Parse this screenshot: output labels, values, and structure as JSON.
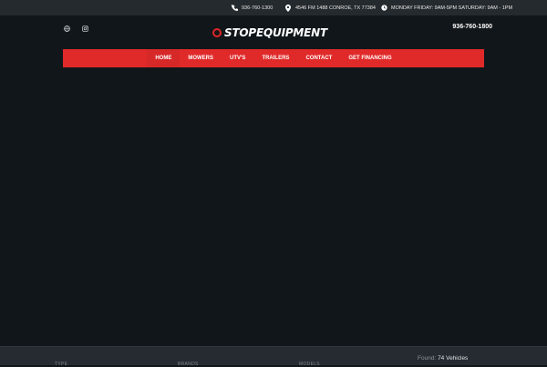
{
  "topbar": {
    "phone": "936-760-1300",
    "address": "4546 FM 1488 CONROE, TX 77384",
    "hours": "MONDAY FRIDAY: 9AM-5PM SATURDAY: 9AM - 1PM"
  },
  "header": {
    "logo_text": "STOPEQUIPMENT",
    "phone": "936-760-1800",
    "social": [
      {
        "icon": "globe-icon"
      },
      {
        "icon": "instagram-icon"
      }
    ]
  },
  "nav": {
    "items": [
      {
        "label": "HOME"
      },
      {
        "label": "MOWERS"
      },
      {
        "label": "UTV'S"
      },
      {
        "label": "TRAILERS"
      },
      {
        "label": "CONTACT"
      },
      {
        "label": "GET FINANCING"
      }
    ]
  },
  "results": {
    "found_label": "Found:",
    "count": "74 Vehicles"
  },
  "filters": [
    {
      "label": "TYPE"
    },
    {
      "label": "BRANDS"
    },
    {
      "label": "MODELS"
    }
  ],
  "colors": {
    "accent": "#e02a2a",
    "background": "#11161a",
    "topbar": "#252a2e"
  }
}
